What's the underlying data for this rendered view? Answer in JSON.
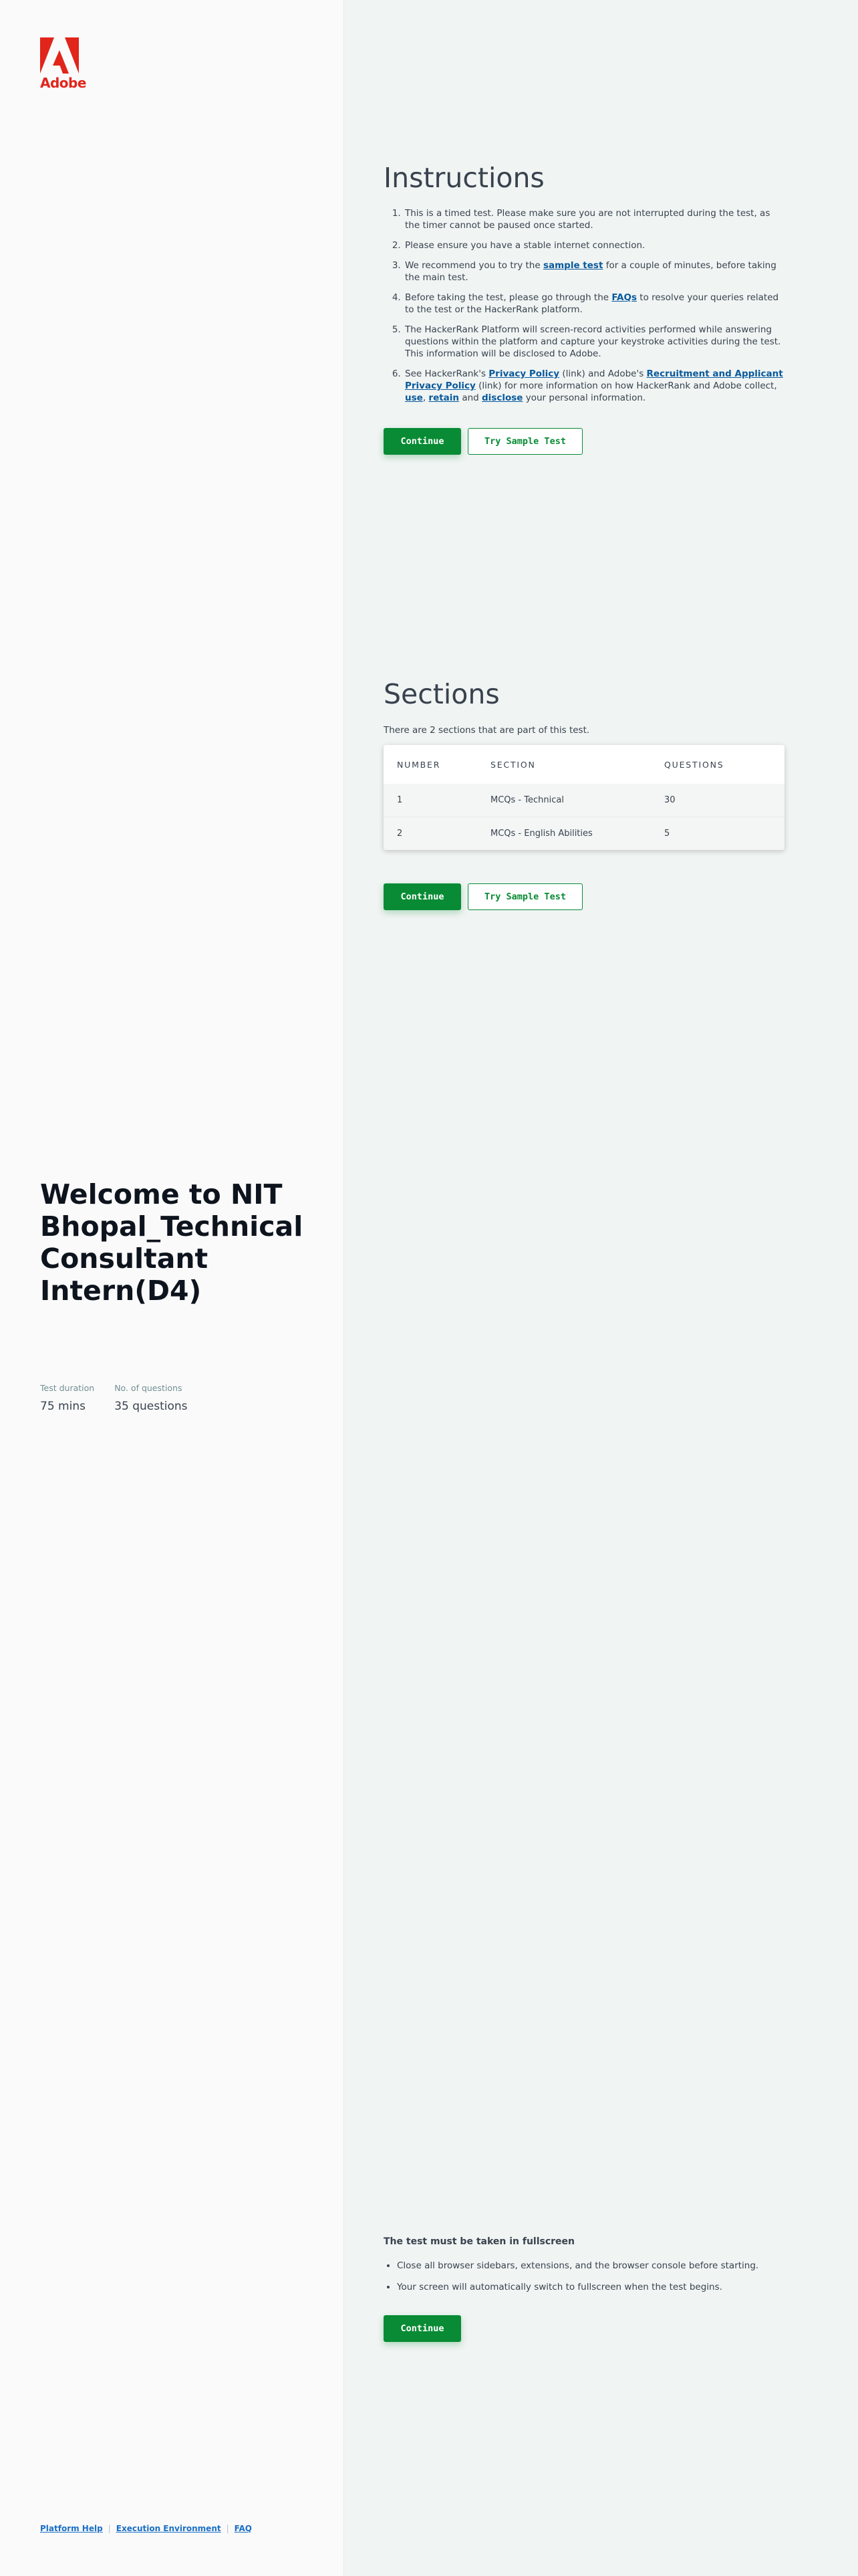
{
  "brand": {
    "name": "Adobe",
    "color": "#e1251b"
  },
  "left": {
    "welcome_title": "Welcome to NIT Bhopal_Technical Consultant Intern(D4)",
    "stats": [
      {
        "label": "Test duration",
        "value": "75 mins"
      },
      {
        "label": "No. of questions",
        "value": "35 questions"
      }
    ],
    "footer_links": [
      "Platform Help",
      "Execution Environment",
      "FAQ"
    ],
    "footer_separator": "|"
  },
  "instructions": {
    "title": "Instructions",
    "items": [
      {
        "parts": [
          {
            "t": "This is a timed test. Please make sure you are not interrupted during the test, as the timer cannot be paused once started."
          }
        ]
      },
      {
        "parts": [
          {
            "t": "Please ensure you have a stable internet connection."
          }
        ]
      },
      {
        "parts": [
          {
            "t": "We recommend you to try the "
          },
          {
            "t": "sample test",
            "link": true
          },
          {
            "t": " for a couple of minutes, before taking the main test."
          }
        ]
      },
      {
        "parts": [
          {
            "t": "Before taking the test, please go through the "
          },
          {
            "t": "FAQs",
            "link": true
          },
          {
            "t": " to resolve your queries related to the test or the HackerRank platform."
          }
        ]
      },
      {
        "parts": [
          {
            "t": "The HackerRank Platform will screen-record activities performed while answering questions within the platform and capture your keystroke activities during the test. This information will be disclosed to Adobe."
          }
        ]
      },
      {
        "parts": [
          {
            "t": "See HackerRank's "
          },
          {
            "t": "Privacy Policy",
            "link": true
          },
          {
            "t": " (link) and Adobe's "
          },
          {
            "t": "Recruitment and Applicant Privacy Policy",
            "link": true
          },
          {
            "t": " (link) for more information on how HackerRank and Adobe collect, "
          },
          {
            "t": "use",
            "link": true
          },
          {
            "t": ", "
          },
          {
            "t": "retain",
            "link": true
          },
          {
            "t": " and "
          },
          {
            "t": "disclose",
            "link": true
          },
          {
            "t": " your personal information."
          }
        ]
      }
    ],
    "continue_label": "Continue",
    "sample_label": "Try Sample Test"
  },
  "sections": {
    "title": "Sections",
    "description": "There are 2 sections that are part of this test.",
    "columns": [
      "NUMBER",
      "SECTION",
      "QUESTIONS"
    ],
    "rows": [
      {
        "number": "1",
        "section": "MCQs - Technical",
        "questions": "30"
      },
      {
        "number": "2",
        "section": "MCQs - English Abilities",
        "questions": "5"
      }
    ],
    "continue_label": "Continue",
    "sample_label": "Try Sample Test"
  },
  "fullscreen": {
    "title": "The test must be taken in fullscreen",
    "items": [
      "Close all browser sidebars, extensions, and the browser console before starting.",
      "Your screen will automatically switch to fullscreen when the test begins."
    ],
    "continue_label": "Continue"
  }
}
